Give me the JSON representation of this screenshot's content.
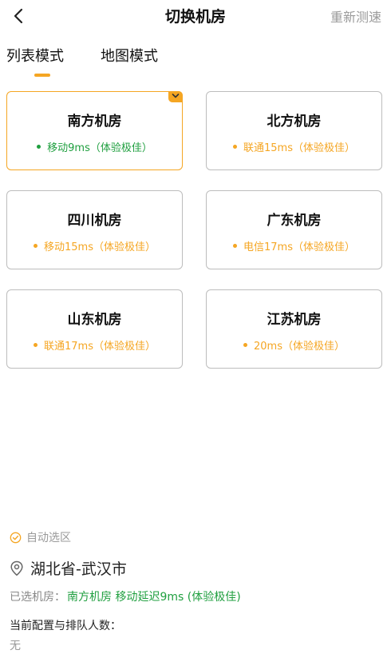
{
  "header": {
    "title": "切换机房",
    "retest_label": "重新测速"
  },
  "tabs": [
    {
      "label": "列表模式",
      "active": true
    },
    {
      "label": "地图模式",
      "active": false
    }
  ],
  "colors": {
    "accent": "#f5a623",
    "good": "#1f9f3f",
    "muted": "#9a9a9a"
  },
  "rooms": [
    {
      "name": "南方机房",
      "status": "移动9ms（体验极佳）",
      "color": "#1f9f3f",
      "selected": true
    },
    {
      "name": "北方机房",
      "status": "联通15ms（体验极佳）",
      "color": "#f5a623",
      "selected": false
    },
    {
      "name": "四川机房",
      "status": "移动15ms（体验极佳）",
      "color": "#f5a623",
      "selected": false
    },
    {
      "name": "广东机房",
      "status": "电信17ms（体验极佳）",
      "color": "#f5a623",
      "selected": false
    },
    {
      "name": "山东机房",
      "status": "联通17ms（体验极佳）",
      "color": "#f5a623",
      "selected": false
    },
    {
      "name": "江苏机房",
      "status": "20ms（体验极佳）",
      "color": "#f5a623",
      "selected": false
    }
  ],
  "footer": {
    "auto_select_label": "自动选区",
    "location": "湖北省-武汉市",
    "selected_label": "已选机房：",
    "selected_value": "南方机房 移动延迟9ms (体验极佳)",
    "config_label": "当前配置与排队人数：",
    "config_value": "无"
  }
}
